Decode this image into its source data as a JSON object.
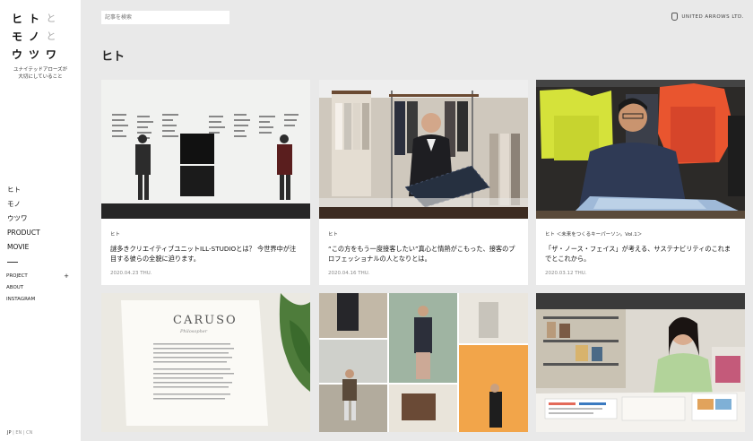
{
  "logo": {
    "row1": [
      "ヒ",
      "ト",
      "と"
    ],
    "row2": [
      "モ",
      "ノ",
      "と"
    ],
    "row3": [
      "ウ",
      "ツ",
      "ワ"
    ]
  },
  "tagline": [
    "ユナイテッドアローズが",
    "大切にしていること"
  ],
  "nav": [
    "ヒト",
    "モノ",
    "ウツワ",
    "PRODUCT",
    "MOVIE"
  ],
  "sub_nav": {
    "project": "PROJECT",
    "project_plus": "+",
    "about": "ABOUT",
    "instagram": "INSTAGRAM"
  },
  "lang": {
    "jp": "JP",
    "sep": "|",
    "en": "EN",
    "cn": "CN"
  },
  "search": {
    "placeholder": "記事を検索"
  },
  "brand": {
    "name": "UNITED ARROWS LTD."
  },
  "page_title": "ヒト",
  "cards": [
    {
      "category": "ヒト",
      "title": "謎多きクリエイティブユニットILL-STUDIOとは？ 今世界中が注目する彼らの全貌に迫ります。",
      "date": "2020.04.23 THU."
    },
    {
      "category": "ヒト",
      "title": "“この方をもう一度接客したい”真心と情熱がこもった、接客のプロフェッショナルの人となりとは。",
      "date": "2020.04.16 THU."
    },
    {
      "category": "ヒト ＜未来をつくるキーパーソン。Vol.1＞",
      "title": "「ザ・ノース・フェイス」が考える、サステナビリティのこれまでとこれから。",
      "date": "2020.03.12 THU."
    }
  ],
  "bottom_cards": {
    "caruso_title": "CARUSO",
    "caruso_sub": "Philosopher"
  }
}
